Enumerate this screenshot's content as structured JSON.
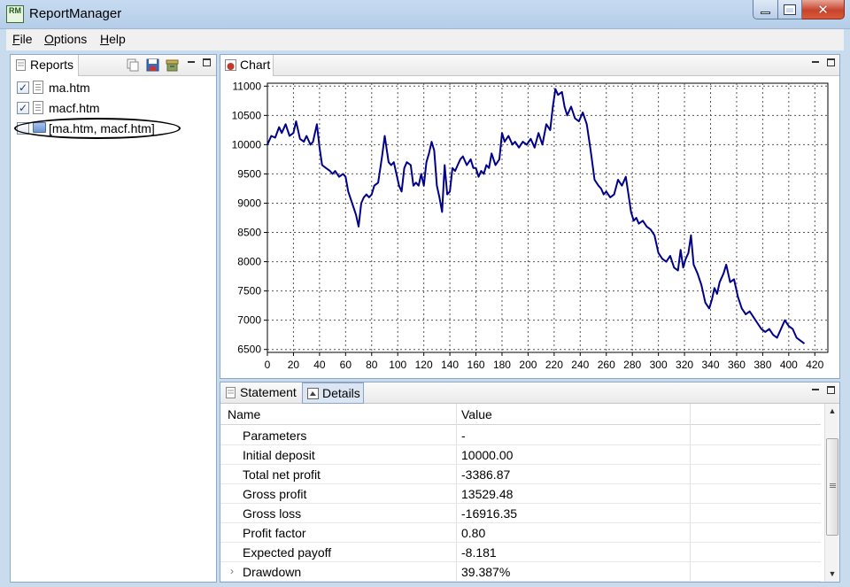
{
  "window": {
    "title": "ReportManager",
    "app_icon": "RM"
  },
  "menu": {
    "file": "File",
    "options": "Options",
    "help": "Help"
  },
  "reports_panel": {
    "tab": "Reports",
    "items": [
      {
        "label": "ma.htm",
        "checked": true
      },
      {
        "label": "macf.htm",
        "checked": true
      },
      {
        "label": "[ma.htm, macf.htm]",
        "checked": false
      }
    ]
  },
  "chart_panel": {
    "tab": "Chart"
  },
  "chart_data": {
    "type": "line",
    "xlim": [
      0,
      430
    ],
    "ylim": [
      6450,
      11050
    ],
    "x_ticks": [
      0,
      20,
      40,
      60,
      80,
      100,
      120,
      140,
      160,
      180,
      200,
      220,
      240,
      260,
      280,
      300,
      320,
      340,
      360,
      380,
      400,
      420
    ],
    "y_ticks": [
      6500,
      7000,
      7500,
      8000,
      8500,
      9000,
      9500,
      10000,
      10500,
      11000
    ],
    "grid": true,
    "color": "#00008b",
    "series": [
      {
        "x": [
          0,
          3,
          6,
          9,
          11,
          14,
          17,
          20,
          22,
          25,
          28,
          30,
          33,
          35,
          38,
          40,
          42,
          45,
          48,
          50,
          52,
          55,
          58,
          60,
          62,
          65,
          68,
          70,
          72,
          74,
          76,
          78,
          80,
          82,
          85,
          88,
          90,
          93,
          95,
          97,
          99,
          101,
          103,
          105,
          107,
          110,
          112,
          114,
          116,
          118,
          120,
          122,
          124,
          126,
          128,
          130,
          132,
          134,
          136,
          138,
          140,
          142,
          144,
          146,
          148,
          150,
          153,
          156,
          158,
          160,
          162,
          164,
          166,
          168,
          170,
          172,
          175,
          178,
          180,
          182,
          185,
          188,
          190,
          193,
          196,
          199,
          202,
          205,
          208,
          211,
          214,
          217,
          219,
          221,
          223,
          226,
          228,
          230,
          233,
          236,
          239,
          242,
          245,
          248,
          251,
          254,
          256,
          258,
          260,
          263,
          266,
          269,
          272,
          275,
          277,
          279,
          281,
          283,
          285,
          288,
          291,
          294,
          297,
          300,
          303,
          306,
          309,
          312,
          315,
          317,
          319,
          321,
          323,
          325,
          327,
          330,
          333,
          336,
          339,
          341,
          343,
          345,
          347,
          350,
          352,
          355,
          358,
          361,
          364,
          367,
          370,
          373,
          376,
          379,
          382,
          385,
          388,
          391,
          394,
          397,
          400,
          403,
          406,
          409,
          412
        ],
        "y": [
          10000,
          10150,
          10120,
          10300,
          10200,
          10350,
          10150,
          10200,
          10400,
          10100,
          10050,
          10150,
          10000,
          10050,
          10350,
          9950,
          9650,
          9600,
          9550,
          9500,
          9550,
          9450,
          9500,
          9450,
          9200,
          9000,
          8800,
          8600,
          9000,
          9100,
          9150,
          9100,
          9150,
          9300,
          9350,
          9800,
          10150,
          9700,
          9650,
          9700,
          9500,
          9300,
          9200,
          9600,
          9700,
          9650,
          9300,
          9350,
          9300,
          9500,
          9300,
          9700,
          9850,
          10050,
          9900,
          9300,
          9100,
          8850,
          9650,
          9150,
          9200,
          9600,
          9550,
          9650,
          9750,
          9800,
          9650,
          9750,
          9600,
          9600,
          9450,
          9550,
          9500,
          9650,
          9600,
          9850,
          9650,
          9750,
          10200,
          10050,
          10150,
          10000,
          10050,
          9950,
          10050,
          10000,
          10100,
          9950,
          10200,
          10000,
          10350,
          10250,
          10650,
          10950,
          10850,
          10900,
          10650,
          10500,
          10650,
          10450,
          10400,
          10550,
          10350,
          9900,
          9400,
          9300,
          9250,
          9150,
          9200,
          9100,
          9150,
          9400,
          9300,
          9450,
          9150,
          8850,
          8700,
          8750,
          8650,
          8700,
          8600,
          8550,
          8450,
          8150,
          8050,
          8000,
          8100,
          7900,
          7850,
          8200,
          7900,
          8050,
          8150,
          8450,
          7950,
          7800,
          7600,
          7300,
          7200,
          7350,
          7550,
          7450,
          7650,
          7800,
          7950,
          7650,
          7700,
          7400,
          7200,
          7100,
          7150,
          7050,
          6950,
          6850,
          6800,
          6850,
          6750,
          6700,
          6850,
          7000,
          6900,
          6850,
          6700,
          6650,
          6600
        ]
      }
    ]
  },
  "details_panel": {
    "tabs": [
      "Statement",
      "Details"
    ],
    "columns": [
      "Name",
      "Value"
    ],
    "rows": [
      {
        "name": "Parameters",
        "value": "-"
      },
      {
        "name": "Initial deposit",
        "value": "10000.00"
      },
      {
        "name": "Total net profit",
        "value": "-3386.87"
      },
      {
        "name": "Gross profit",
        "value": "13529.48"
      },
      {
        "name": "Gross loss",
        "value": "-16916.35"
      },
      {
        "name": "Profit factor",
        "value": "0.80"
      },
      {
        "name": "Expected payoff",
        "value": "-8.181"
      },
      {
        "name": "Drawdown",
        "value": "39.387%",
        "expandable": true
      }
    ]
  }
}
